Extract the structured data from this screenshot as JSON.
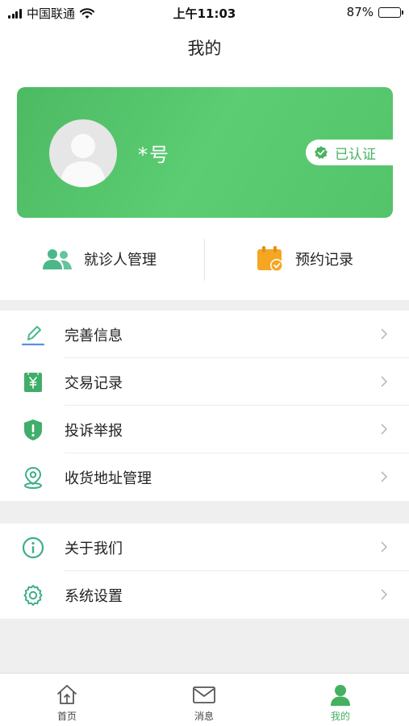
{
  "status_bar": {
    "carrier": "中国联通",
    "time": "上午11:03",
    "battery_percent": "87%",
    "battery_level": 0.87
  },
  "header": {
    "title": "我的"
  },
  "profile": {
    "name": "*号",
    "verified_label": "已认证",
    "card_color": "#52c26b"
  },
  "quick_actions": [
    {
      "label": "就诊人管理",
      "icon": "patients-icon"
    },
    {
      "label": "预约记录",
      "icon": "appointment-calendar-icon"
    }
  ],
  "menu_group_1": [
    {
      "label": "完善信息",
      "icon": "edit-pen-icon"
    },
    {
      "label": "交易记录",
      "icon": "yuan-receipt-icon"
    },
    {
      "label": "投诉举报",
      "icon": "shield-alert-icon"
    },
    {
      "label": "收货地址管理",
      "icon": "location-pin-icon"
    }
  ],
  "menu_group_2": [
    {
      "label": "关于我们",
      "icon": "info-icon"
    },
    {
      "label": "系统设置",
      "icon": "gear-icon"
    }
  ],
  "tab_bar": [
    {
      "label": "首页",
      "icon": "home-icon",
      "active": false
    },
    {
      "label": "消息",
      "icon": "mail-icon",
      "active": false
    },
    {
      "label": "我的",
      "icon": "person-icon",
      "active": true
    }
  ],
  "colors": {
    "accent_green": "#45b05e",
    "background_gray": "#efefef",
    "appointment_orange": "#f5a623"
  }
}
